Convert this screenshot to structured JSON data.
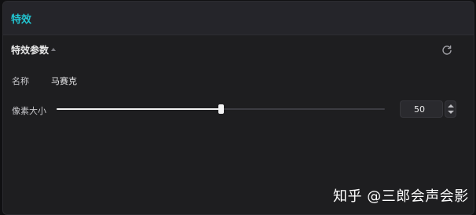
{
  "header": {
    "title": "特效"
  },
  "section": {
    "title": "特效参数",
    "reset_icon": "reset-icon"
  },
  "name_row": {
    "label": "名称",
    "value": "马赛克"
  },
  "pixel_row": {
    "label": "像素大小",
    "value": "50",
    "slider_fraction": 0.5
  },
  "watermark": "知乎 @三郎会声会影",
  "colors": {
    "accent": "#22c3cf",
    "panel_bg": "#1e1e20",
    "header_bg": "#25252a"
  }
}
